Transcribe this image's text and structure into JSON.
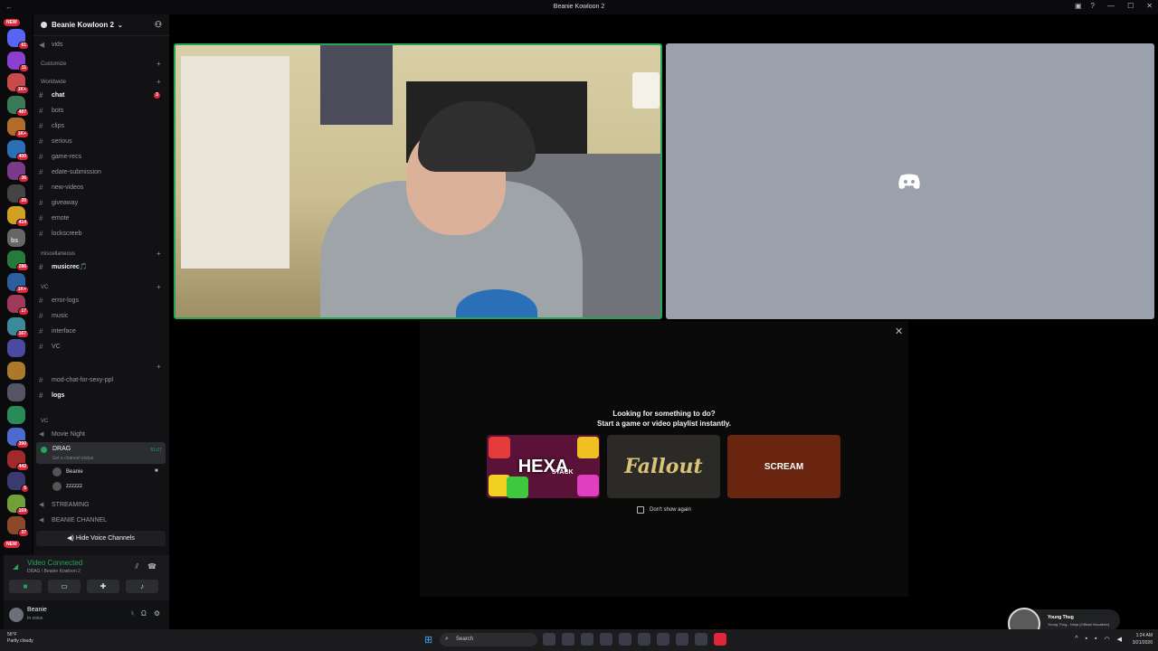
{
  "titlebar": {
    "title": "Beanie Kowloon 2"
  },
  "rail": {
    "new_badge": "NEW",
    "servers": [
      {
        "badge": "61"
      },
      {
        "badge": "11"
      },
      {
        "badge": "1K+"
      },
      {
        "badge": "487"
      },
      {
        "badge": "1K+"
      },
      {
        "badge": "400"
      },
      {
        "badge": "36"
      },
      {
        "badge": "20"
      },
      {
        "badge": "414"
      },
      {
        "badge": ""
      },
      {
        "badge": "286"
      },
      {
        "badge": "1K+"
      },
      {
        "badge": "17"
      },
      {
        "badge": "167"
      },
      {
        "badge": ""
      },
      {
        "badge": ""
      },
      {
        "badge": ""
      },
      {
        "badge": ""
      },
      {
        "badge": "390"
      },
      {
        "badge": "442"
      },
      {
        "badge": "5"
      },
      {
        "badge": "169"
      },
      {
        "badge": "37"
      }
    ],
    "text_server": "bs",
    "new_badge_bottom": "NEW"
  },
  "sidebar": {
    "server_name": "Beanie Kowloon 2",
    "vids": "vids",
    "customize": "Customize",
    "cat_worldwide": "Worldwide",
    "channels1": [
      {
        "name": "chat",
        "bold": true,
        "unread": "3"
      },
      {
        "name": "bots"
      },
      {
        "name": "clips"
      },
      {
        "name": "serious"
      },
      {
        "name": "game-recs"
      },
      {
        "name": "edate-submission"
      },
      {
        "name": "new-videos"
      },
      {
        "name": "giveaway"
      },
      {
        "name": "emote"
      },
      {
        "name": "lockscreeb"
      }
    ],
    "cat_misc": "miscellaneous",
    "musicrec": "musicrec🎵",
    "cat_vc": "VC",
    "channels2": [
      "error-logs",
      "music",
      "interface",
      "VC"
    ],
    "mod_chat": "mod-chat-for-sexy-ppl",
    "logs": "logs",
    "cat_vc2": "VC",
    "movie_night": "Movie Night",
    "drag": {
      "name": "DRAG",
      "status": "Set a channel status",
      "time": "51:07"
    },
    "members": [
      "Beanie",
      "zzzzzz"
    ],
    "streaming": "STREAMING",
    "beanie_channel": "BEANIE CHANNEL",
    "hide_vc": "Hide Voice Channels"
  },
  "voice_panel": {
    "title": "Video Connected",
    "sub": "DRAG / Beanie Kowloon 2"
  },
  "user": {
    "name": "Beanie",
    "status": "In voice"
  },
  "modal": {
    "line1": "Looking for something to do?",
    "line2": "Start a game or video playlist instantly.",
    "cards": [
      {
        "title": "HEXA",
        "sub": "STACK"
      },
      {
        "title": "Fallout"
      },
      {
        "title": "SCREAM"
      }
    ],
    "dont_show": "Don't show again"
  },
  "taskbar": {
    "temp": "56°F",
    "weather": "Partly cloudy",
    "search": "Search",
    "time": "1:24 AM",
    "date": "3/21/2026"
  },
  "now_playing": {
    "artist": "Young Thug",
    "song": "Young Thug - Ninja (Official Visualizer)"
  },
  "colors": {
    "accent_green": "#23a55a",
    "alert_red": "#e0263c",
    "bg": "#000000"
  }
}
